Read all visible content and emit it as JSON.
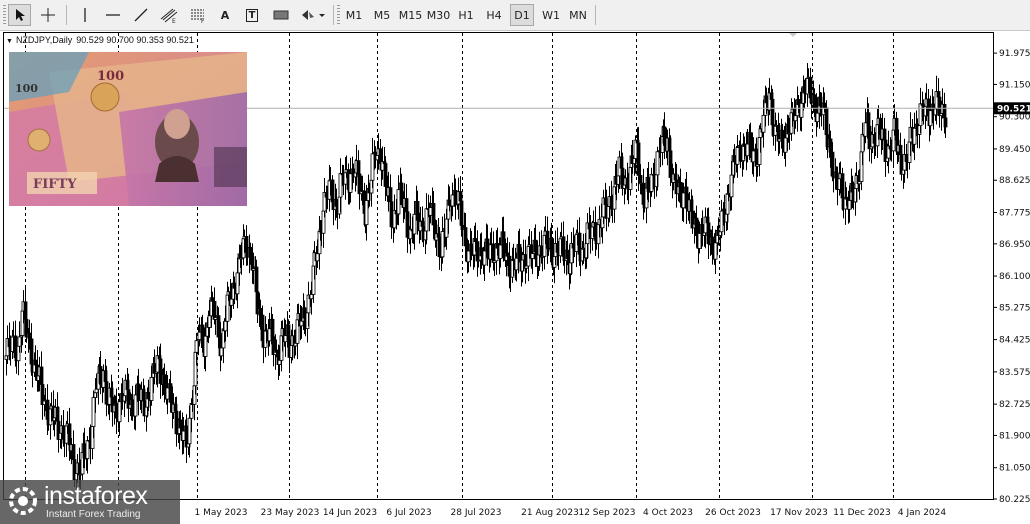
{
  "toolbar": {
    "tools": [
      {
        "name": "cursor-icon"
      },
      {
        "name": "crosshair-icon"
      },
      {
        "name": "vertical-line-icon"
      },
      {
        "name": "horizontal-line-icon"
      },
      {
        "name": "trendline-icon"
      },
      {
        "name": "channel-icon"
      },
      {
        "name": "fibonacci-icon"
      },
      {
        "name": "text-icon",
        "label": "A"
      },
      {
        "name": "text-label-icon",
        "label": "T"
      },
      {
        "name": "rectangle-icon"
      },
      {
        "name": "shapes-dropdown-icon"
      }
    ],
    "timeframes": [
      "M1",
      "M5",
      "M15",
      "M30",
      "H1",
      "H4",
      "D1",
      "W1",
      "MN"
    ],
    "active_timeframe": "D1"
  },
  "chart_header": {
    "symbol": "NZDJPY,Daily",
    "ohlc": "90.529 90.700 90.353 90.521"
  },
  "logo": {
    "name": "instaforex",
    "tagline": "Instant Forex Trading"
  },
  "chart_data": {
    "type": "candlestick",
    "symbol": "NZDJPY",
    "timeframe": "Daily",
    "ylim": [
      80.225,
      92.4
    ],
    "y_ticks": [
      "91.975",
      "91.150",
      "90.300",
      "89.450",
      "88.625",
      "87.775",
      "86.950",
      "86.100",
      "85.275",
      "84.425",
      "83.575",
      "82.725",
      "81.900",
      "81.050",
      "80.225"
    ],
    "x_ticks": [
      "1 May 2023",
      "23 May 2023",
      "14 Jun 2023",
      "6 Jul 2023",
      "28 Jul 2023",
      "21 Aug 2023",
      "12 Sep 2023",
      "4 Oct 2023",
      "26 Oct 2023",
      "17 Nov 2023",
      "11 Dec 2023",
      "4 Jan 2024"
    ],
    "current_price": "90.521",
    "grid": "vertical dashed separators",
    "anchors": [
      [
        0,
        84.0
      ],
      [
        5,
        84.3
      ],
      [
        8,
        84.2
      ],
      [
        11,
        85.1
      ],
      [
        15,
        84.5
      ],
      [
        20,
        83.6
      ],
      [
        25,
        83.0
      ],
      [
        30,
        82.4
      ],
      [
        36,
        82.2
      ],
      [
        42,
        81.8
      ],
      [
        46,
        81.3
      ],
      [
        50,
        80.9
      ],
      [
        55,
        81.5
      ],
      [
        58,
        82.0
      ],
      [
        62,
        83.2
      ],
      [
        67,
        83.6
      ],
      [
        70,
        82.8
      ],
      [
        75,
        82.5
      ],
      [
        80,
        83.0
      ],
      [
        86,
        82.7
      ],
      [
        90,
        83.0
      ],
      [
        94,
        82.6
      ],
      [
        100,
        83.3
      ],
      [
        105,
        83.8
      ],
      [
        108,
        83.4
      ],
      [
        112,
        82.8
      ],
      [
        116,
        82.5
      ],
      [
        120,
        82.0
      ],
      [
        124,
        81.6
      ],
      [
        128,
        83.1
      ],
      [
        132,
        84.5
      ],
      [
        136,
        84.4
      ],
      [
        140,
        85.2
      ],
      [
        144,
        85.0
      ],
      [
        148,
        84.3
      ],
      [
        152,
        85.2
      ],
      [
        156,
        85.8
      ],
      [
        161,
        86.5
      ],
      [
        165,
        87.0
      ],
      [
        169,
        86.6
      ],
      [
        173,
        85.2
      ],
      [
        177,
        84.6
      ],
      [
        181,
        84.6
      ],
      [
        186,
        84.0
      ],
      [
        190,
        84.5
      ],
      [
        195,
        84.3
      ],
      [
        200,
        84.7
      ],
      [
        205,
        85.0
      ],
      [
        210,
        85.8
      ],
      [
        214,
        86.8
      ],
      [
        218,
        88.0
      ],
      [
        222,
        88.3
      ],
      [
        227,
        88.0
      ],
      [
        231,
        88.6
      ],
      [
        235,
        88.6
      ],
      [
        239,
        89.0
      ],
      [
        243,
        88.4
      ],
      [
        247,
        87.9
      ],
      [
        251,
        88.6
      ],
      [
        254,
        89.4
      ],
      [
        258,
        89.3
      ],
      [
        262,
        88.2
      ],
      [
        266,
        87.6
      ],
      [
        270,
        88.2
      ],
      [
        274,
        87.9
      ],
      [
        278,
        87.2
      ],
      [
        282,
        87.6
      ],
      [
        286,
        87.4
      ],
      [
        291,
        87.8
      ],
      [
        295,
        87.4
      ],
      [
        299,
        86.8
      ],
      [
        302,
        87.2
      ],
      [
        306,
        88.4
      ],
      [
        310,
        88.1
      ],
      [
        315,
        87.2
      ],
      [
        319,
        86.7
      ],
      [
        323,
        86.7
      ],
      [
        328,
        86.8
      ],
      [
        332,
        86.6
      ],
      [
        337,
        86.9
      ],
      [
        341,
        86.8
      ],
      [
        345,
        86.5
      ],
      [
        349,
        86.4
      ],
      [
        354,
        86.5
      ],
      [
        358,
        86.7
      ],
      [
        362,
        86.6
      ],
      [
        366,
        86.8
      ],
      [
        371,
        86.9
      ],
      [
        375,
        86.8
      ],
      [
        379,
        86.8
      ],
      [
        383,
        86.7
      ],
      [
        388,
        86.6
      ],
      [
        392,
        86.9
      ],
      [
        396,
        86.8
      ],
      [
        400,
        87.1
      ],
      [
        405,
        87.3
      ],
      [
        409,
        87.6
      ],
      [
        413,
        87.8
      ],
      [
        417,
        88.3
      ],
      [
        422,
        88.8
      ],
      [
        426,
        88.6
      ],
      [
        430,
        88.9
      ],
      [
        434,
        89.5
      ],
      [
        438,
        88.1
      ],
      [
        442,
        88.3
      ],
      [
        446,
        88.9
      ],
      [
        450,
        89.5
      ],
      [
        455,
        89.7
      ],
      [
        459,
        88.5
      ],
      [
        463,
        88.2
      ],
      [
        467,
        88.4
      ],
      [
        471,
        87.5
      ],
      [
        476,
        87.3
      ],
      [
        480,
        87.3
      ],
      [
        485,
        87.0
      ],
      [
        489,
        87.0
      ],
      [
        493,
        87.6
      ],
      [
        497,
        88.4
      ],
      [
        501,
        89.0
      ],
      [
        505,
        89.5
      ],
      [
        509,
        89.5
      ],
      [
        513,
        89.3
      ],
      [
        517,
        89.4
      ],
      [
        521,
        90.2
      ],
      [
        525,
        91.0
      ],
      [
        529,
        89.8
      ],
      [
        533,
        89.6
      ],
      [
        537,
        90.0
      ],
      [
        541,
        90.1
      ],
      [
        545,
        90.7
      ],
      [
        550,
        91.0
      ],
      [
        554,
        90.9
      ],
      [
        558,
        90.5
      ],
      [
        562,
        90.4
      ],
      [
        566,
        89.7
      ],
      [
        570,
        88.4
      ],
      [
        574,
        88.6
      ],
      [
        578,
        88.0
      ],
      [
        582,
        88.1
      ],
      [
        587,
        89.0
      ],
      [
        591,
        90.1
      ],
      [
        595,
        89.7
      ],
      [
        599,
        89.9
      ],
      [
        603,
        89.7
      ],
      [
        607,
        89.4
      ],
      [
        611,
        89.8
      ],
      [
        615,
        89.3
      ],
      [
        619,
        89.0
      ],
      [
        623,
        89.8
      ],
      [
        627,
        90.2
      ],
      [
        631,
        90.4
      ],
      [
        635,
        90.5
      ],
      [
        639,
        90.6
      ],
      [
        643,
        90.4
      ],
      [
        646,
        90.5
      ]
    ]
  }
}
